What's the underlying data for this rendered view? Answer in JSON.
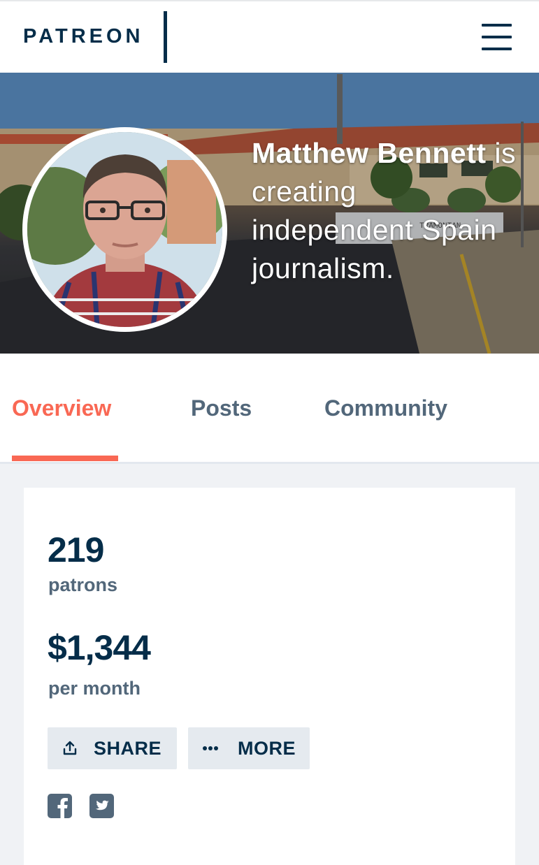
{
  "header": {
    "logo": "PATREON",
    "menu_icon": "hamburger-menu-icon"
  },
  "hero": {
    "creator_name": "Matthew Bennett",
    "tagline_suffix": " is creating independent Spain journalism."
  },
  "tabs": [
    {
      "label": "Overview",
      "active": true
    },
    {
      "label": "Posts",
      "active": false
    },
    {
      "label": "Community",
      "active": false
    }
  ],
  "stats": {
    "patrons_count": "219",
    "patrons_label": "patrons",
    "earnings": "$1,344",
    "earnings_label": "per month"
  },
  "actions": {
    "share_label": "SHARE",
    "share_icon": "share-upload-icon",
    "more_label": "MORE",
    "more_icon": "ellipsis-icon"
  },
  "social": [
    {
      "icon": "facebook-icon"
    },
    {
      "icon": "twitter-icon"
    }
  ],
  "colors": {
    "brand_navy": "#052d49",
    "accent_coral": "#f96854",
    "muted_text": "#52677a",
    "button_bg": "#e5eaef",
    "page_bg": "#f0f2f5"
  }
}
